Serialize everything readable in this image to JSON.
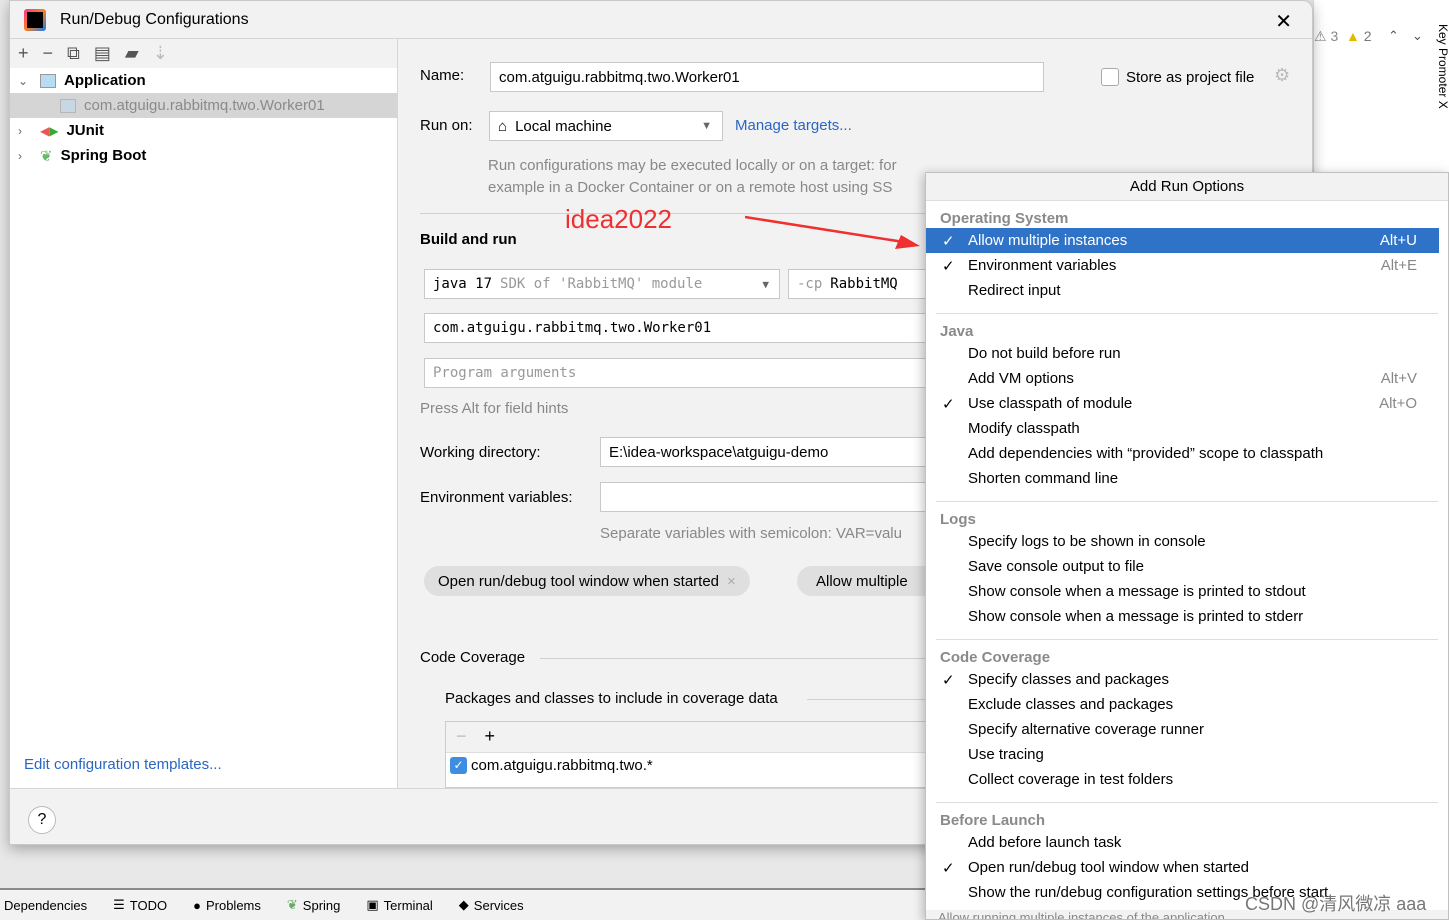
{
  "dialog": {
    "title": "Run/Debug Configurations",
    "close_icon": "close-icon"
  },
  "toolbar": [
    "add-icon",
    "remove-icon",
    "copy-icon",
    "save-icon",
    "new-folder-icon",
    "sort-icon"
  ],
  "tree": {
    "application": "Application",
    "worker": "com.atguigu.rabbitmq.two.Worker01",
    "junit": "JUnit",
    "spring_boot": "Spring Boot"
  },
  "edit_templates": "Edit configuration templates...",
  "form": {
    "name_label": "Name:",
    "name_value": "com.atguigu.rabbitmq.two.Worker01",
    "store_label": "Store as project file",
    "run_on_label": "Run on:",
    "run_on_value": "Local machine",
    "manage_targets": "Manage targets...",
    "run_hint_1": "Run configurations may be executed locally or on a target: for",
    "run_hint_2": "example in a Docker Container or on a remote host using SS",
    "annotation": "idea2022",
    "build_run": "Build and run",
    "jdk_main": "java 17",
    "jdk_sub": "SDK of 'RabbitMQ' module",
    "cp_prefix": "-cp",
    "cp_value": "RabbitMQ",
    "main_class": "com.atguigu.rabbitmq.two.Worker01",
    "program_args_placeholder": "Program arguments",
    "alt_hint": "Press Alt for field hints",
    "workdir_label": "Working directory:",
    "workdir_value": "E:\\idea-workspace\\atguigu-demo",
    "env_label": "Environment variables:",
    "env_value": "",
    "env_hint": "Separate variables with semicolon: VAR=valu",
    "chip_open": "Open run/debug tool window when started",
    "chip_allow": "Allow multiple",
    "code_coverage": "Code Coverage",
    "packages_label": "Packages and classes to include in coverage data",
    "package_entry": "com.atguigu.rabbitmq.two.*",
    "package_checked": true
  },
  "popup": {
    "title": "Add Run Options",
    "groups": [
      {
        "name": "Operating System",
        "items": [
          {
            "label": "Allow multiple instances",
            "checked": true,
            "shortcut": "Alt+U",
            "selected": true
          },
          {
            "label": "Environment variables",
            "checked": true,
            "shortcut": "Alt+E"
          },
          {
            "label": "Redirect input"
          }
        ]
      },
      {
        "name": "Java",
        "items": [
          {
            "label": "Do not build before run"
          },
          {
            "label": "Add VM options",
            "shortcut": "Alt+V"
          },
          {
            "label": "Use classpath of module",
            "checked": true,
            "shortcut": "Alt+O"
          },
          {
            "label": "Modify classpath"
          },
          {
            "label": "Add dependencies with “provided” scope to classpath"
          },
          {
            "label": "Shorten command line"
          }
        ]
      },
      {
        "name": "Logs",
        "items": [
          {
            "label": "Specify logs to be shown in console"
          },
          {
            "label": "Save console output to file"
          },
          {
            "label": "Show console when a message is printed to stdout"
          },
          {
            "label": "Show console when a message is printed to stderr"
          }
        ]
      },
      {
        "name": "Code Coverage",
        "items": [
          {
            "label": "Specify classes and packages",
            "checked": true
          },
          {
            "label": "Exclude classes and packages"
          },
          {
            "label": "Specify alternative coverage runner"
          },
          {
            "label": "Use tracing"
          },
          {
            "label": "Collect coverage in test folders"
          }
        ]
      },
      {
        "name": "Before Launch",
        "items": [
          {
            "label": "Add before launch task"
          },
          {
            "label": "Open run/debug tool window when started",
            "checked": true
          },
          {
            "label": "Show the run/debug configuration settings before start"
          }
        ]
      }
    ],
    "hint": "Allow running multiple instances of the application"
  },
  "ide": {
    "warn1": "3",
    "warn2": "2",
    "key_promoter": "Key Promoter X",
    "tabs": [
      "Dependencies",
      "TODO",
      "Problems",
      "Spring",
      "Terminal",
      "Services"
    ]
  },
  "watermark": "CSDN @清风微凉 aaa",
  "colors": {
    "selection": "#2f73c8",
    "link": "#2a66c4",
    "annotation": "#f03030"
  }
}
